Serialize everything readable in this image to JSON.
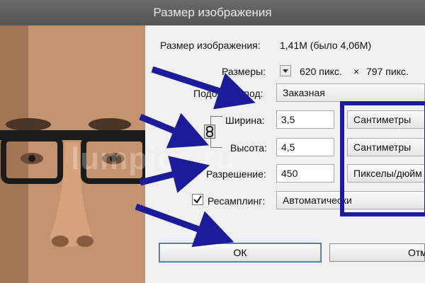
{
  "window": {
    "title": "Размер изображения"
  },
  "info": {
    "size_label": "Размер изображения:",
    "size_value": "1,41M (было 4,06M)",
    "dims_label": "Размеры:",
    "dims_width": "620 пикс.",
    "dims_times": "×",
    "dims_height": "797 пикс."
  },
  "fit": {
    "label": "Подогнать под:",
    "value": "Заказная"
  },
  "width": {
    "label": "Ширина:",
    "value": "3,5",
    "unit": "Сантиметры"
  },
  "height": {
    "label": "Высота:",
    "value": "4,5",
    "unit": "Сантиметры"
  },
  "resolution": {
    "label": "Разрешение:",
    "value": "450",
    "unit": "Пикселы/дюйм"
  },
  "resample": {
    "checked": true,
    "label": "Ресамплинг:",
    "value": "Автоматически"
  },
  "buttons": {
    "ok": "ОК",
    "cancel": "Отмена"
  },
  "watermark": "lumpics.ru",
  "colors": {
    "annotation": "#1c1c9a",
    "panel": "#f0f0f0",
    "titlebar": "#5c5c5c"
  }
}
